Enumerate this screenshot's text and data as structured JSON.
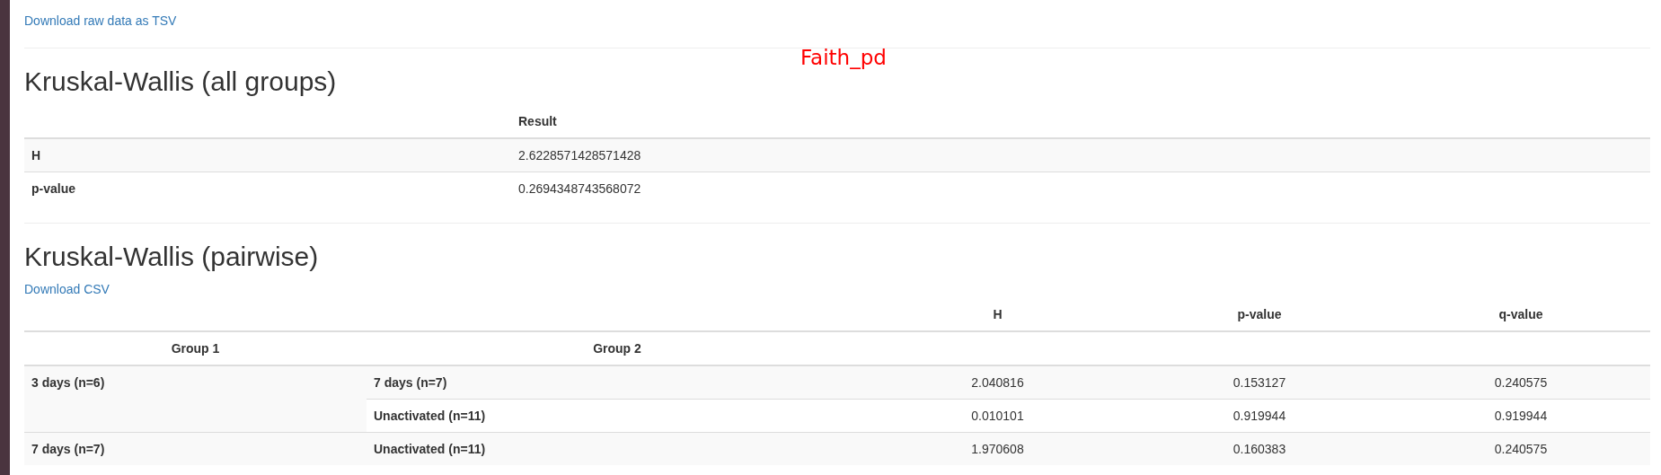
{
  "download_link": "Download raw data as TSV",
  "annotation": "Faith_pd",
  "overall": {
    "title": "Kruskal-Wallis (all groups)",
    "columns": [
      "Result"
    ],
    "rows": [
      {
        "label": "H",
        "value": "2.6228571428571428"
      },
      {
        "label": "p-value",
        "value": "0.2694348743568072"
      }
    ]
  },
  "pairwise": {
    "title": "Kruskal-Wallis (pairwise)",
    "download_link": "Download CSV",
    "columns": [
      "H",
      "p-value",
      "q-value"
    ],
    "index_names": [
      "Group 1",
      "Group 2"
    ],
    "groups": [
      {
        "group_1": "3 days (n=6)",
        "comparisons": [
          {
            "group_2": "7 days (n=7)",
            "values": [
              "2.040816",
              "0.153127",
              "0.240575"
            ]
          },
          {
            "group_2": "Unactivated (n=11)",
            "values": [
              "0.010101",
              "0.919944",
              "0.919944"
            ]
          }
        ]
      },
      {
        "group_1": "7 days (n=7)",
        "comparisons": [
          {
            "group_2": "Unactivated (n=11)",
            "values": [
              "1.970608",
              "0.160383",
              "0.240575"
            ]
          }
        ]
      }
    ]
  }
}
